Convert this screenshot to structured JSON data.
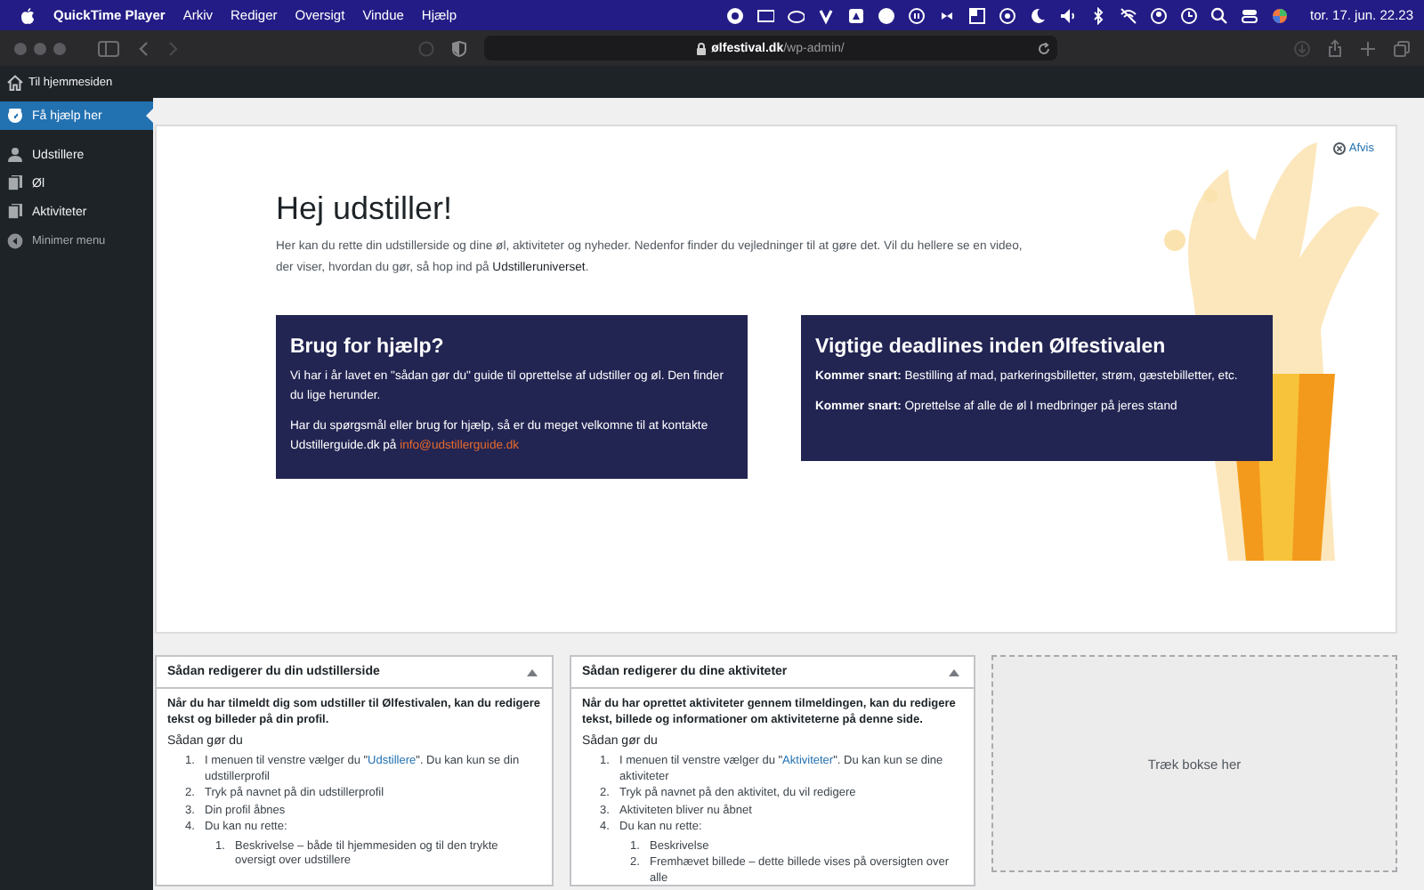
{
  "menu_bar": {
    "app": "QuickTime Player",
    "menus": [
      "Arkiv",
      "Rediger",
      "Oversigt",
      "Vindue",
      "Hjælp"
    ],
    "clock": "tor. 17. jun. 22.23"
  },
  "browser": {
    "url_domain": "ølfestival.dk",
    "url_path": "/wp-admin/"
  },
  "admin_bar": {
    "home_label": "Til hjemmesiden"
  },
  "sidebar": {
    "items": [
      {
        "label": "Få hjælp her",
        "selected": true,
        "kind": "help"
      },
      {
        "label": "Udstillere",
        "selected": false,
        "kind": "person"
      },
      {
        "label": "Øl",
        "selected": false,
        "kind": "pages"
      },
      {
        "label": "Aktiviteter",
        "selected": false,
        "kind": "pages"
      }
    ],
    "collapse_label": "Minimer menu"
  },
  "welcome": {
    "dismiss": "Afvis",
    "title": "Hej udstiller!",
    "intro": "Her kan du rette din udstillerside og dine øl, aktiviteter og nyheder. Nedenfor finder du vejledninger til at gøre det. Vil du hellere se en video, der viser, hvordan du gør, så hop ind på ",
    "intro_link": "Udstilleruniverset",
    "intro_end": ".",
    "cards": [
      {
        "title": "Brug for hjælp?",
        "paragraphs": [
          {
            "text": "Vi har i år lavet en \"sådan gør du\" guide til oprettelse af udstiller og øl. Den finder du lige herunder."
          },
          {
            "text": "Har du spørgsmål eller brug for hjælp, så er du meget velkomne til at kontakte Udstillerguide.dk på ",
            "link": "info@udstillerguide.dk"
          }
        ]
      },
      {
        "title": "Vigtige deadlines inden Ølfestivalen",
        "paragraphs": [
          {
            "text": "**Kommer snart:** Bestilling af mad, parkeringsbilletter, strøm, gæstebilletter, etc."
          },
          {
            "text": "**Kommer snart:** Oprettelse af alle de øl I medbringer på jeres stand"
          }
        ]
      }
    ]
  },
  "boxes": [
    {
      "title": "Sådan redigerer du din udstillerside",
      "expanded": true,
      "lead": "Når du har tilmeldt dig som udstiller til Ølfestivalen, kan du redigere tekst og billeder på din profil.",
      "subheading": "Sådan gør du",
      "steps": [
        {
          "number": "1.",
          "text": "I menuen til venstre vælger du \"",
          "link": "Udstillere",
          "after": "\". Du kan kun se din udstillerprofil"
        },
        {
          "number": "2.",
          "text": "Tryk på navnet på din udstillerprofil"
        },
        {
          "number": "3.",
          "text": "Din profil åbnes"
        },
        {
          "number": "4.",
          "text": "Du kan nu rette:",
          "children": [
            {
              "number": "1.",
              "text": "Beskrivelse – både til hjemmesiden og til den trykte oversigt over udstillere"
            }
          ]
        }
      ]
    },
    {
      "title": "Sådan redigerer du dine aktiviteter",
      "expanded": true,
      "lead": "Når du har oprettet aktiviteter gennem tilmeldingen, kan du redigere tekst, billede og informationer om aktiviteterne på denne side.",
      "subheading": "Sådan gør du",
      "steps": [
        {
          "number": "1.",
          "text": "I menuen til venstre vælger du \"",
          "link": "Aktiviteter",
          "after": "\". Du kan kun se dine aktiviteter"
        },
        {
          "number": "2.",
          "text": "Tryk på navnet på den aktivitet, du vil redigere"
        },
        {
          "number": "3.",
          "text": "Aktiviteten bliver nu åbnet"
        },
        {
          "number": "4.",
          "text": "Du kan nu rette:",
          "children": [
            {
              "number": "1.",
              "text": "Beskrivelse"
            },
            {
              "number": "2.",
              "text": "Fremhævet billede – dette billede vises på oversigten over alle"
            }
          ]
        }
      ]
    }
  ],
  "drop_zone": {
    "label": "Træk bokse her"
  }
}
